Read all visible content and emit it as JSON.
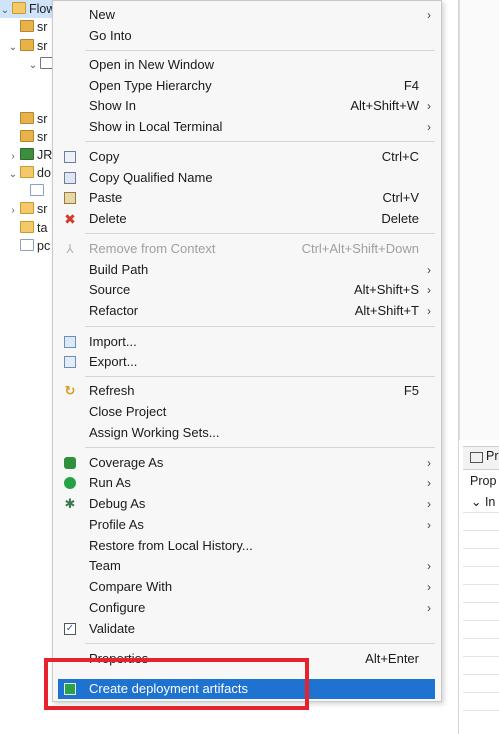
{
  "tree": {
    "rows": [
      {
        "label": "Flow",
        "arrow": "⌄",
        "icon": "folder",
        "indent": 0
      },
      {
        "label": "sr",
        "arrow": "",
        "icon": "pkg",
        "indent": 18
      },
      {
        "label": "sr",
        "arrow": "⌄",
        "icon": "pkg",
        "indent": 8
      },
      {
        "label": "",
        "arrow": "⌄",
        "icon": "grid",
        "indent": 28
      },
      {
        "label": "sr",
        "arrow": "",
        "icon": "pkg",
        "indent": 18
      },
      {
        "label": "sr",
        "arrow": "",
        "icon": "pkg",
        "indent": 18
      },
      {
        "label": "JR",
        "arrow": "›",
        "icon": "jre",
        "indent": 8
      },
      {
        "label": "do",
        "arrow": "⌄",
        "icon": "folder",
        "indent": 8
      },
      {
        "label": "",
        "arrow": "",
        "icon": "file",
        "indent": 28
      },
      {
        "label": "sr",
        "arrow": "›",
        "icon": "folder",
        "indent": 8
      },
      {
        "label": "ta",
        "arrow": "",
        "icon": "folder",
        "indent": 18
      },
      {
        "label": "pc",
        "arrow": "",
        "icon": "file",
        "indent": 18
      }
    ]
  },
  "properties": {
    "tab_label": "Pr",
    "label": "Prop",
    "sub": "⌄ In"
  },
  "menu": {
    "new": {
      "label": "New"
    },
    "go_into": {
      "label": "Go Into"
    },
    "open_new_window": {
      "label": "Open in New Window"
    },
    "open_type_hierarchy": {
      "label": "Open Type Hierarchy",
      "shortcut": "F4"
    },
    "show_in": {
      "label": "Show In",
      "shortcut": "Alt+Shift+W"
    },
    "show_local_terminal": {
      "label": "Show in Local Terminal"
    },
    "copy": {
      "label": "Copy",
      "shortcut": "Ctrl+C"
    },
    "copy_qualified": {
      "label": "Copy Qualified Name"
    },
    "paste": {
      "label": "Paste",
      "shortcut": "Ctrl+V"
    },
    "delete": {
      "label": "Delete",
      "shortcut": "Delete"
    },
    "remove_context": {
      "label": "Remove from Context",
      "shortcut": "Ctrl+Alt+Shift+Down"
    },
    "build_path": {
      "label": "Build Path"
    },
    "source": {
      "label": "Source",
      "shortcut": "Alt+Shift+S"
    },
    "refactor": {
      "label": "Refactor",
      "shortcut": "Alt+Shift+T"
    },
    "import": {
      "label": "Import..."
    },
    "export": {
      "label": "Export..."
    },
    "refresh": {
      "label": "Refresh",
      "shortcut": "F5"
    },
    "close_project": {
      "label": "Close Project"
    },
    "assign_working_sets": {
      "label": "Assign Working Sets..."
    },
    "coverage_as": {
      "label": "Coverage As"
    },
    "run_as": {
      "label": "Run As"
    },
    "debug_as": {
      "label": "Debug As"
    },
    "profile_as": {
      "label": "Profile As"
    },
    "restore_history": {
      "label": "Restore from Local History..."
    },
    "team": {
      "label": "Team"
    },
    "compare_with": {
      "label": "Compare With"
    },
    "configure": {
      "label": "Configure"
    },
    "validate": {
      "label": "Validate"
    },
    "properties": {
      "label": "Properties",
      "shortcut": "Alt+Enter"
    },
    "create_deployment": {
      "label": "Create deployment artifacts"
    },
    "submenu_arrow": "›"
  },
  "highlight_color": "#1e72d0",
  "annotation_color": "#e8222c"
}
